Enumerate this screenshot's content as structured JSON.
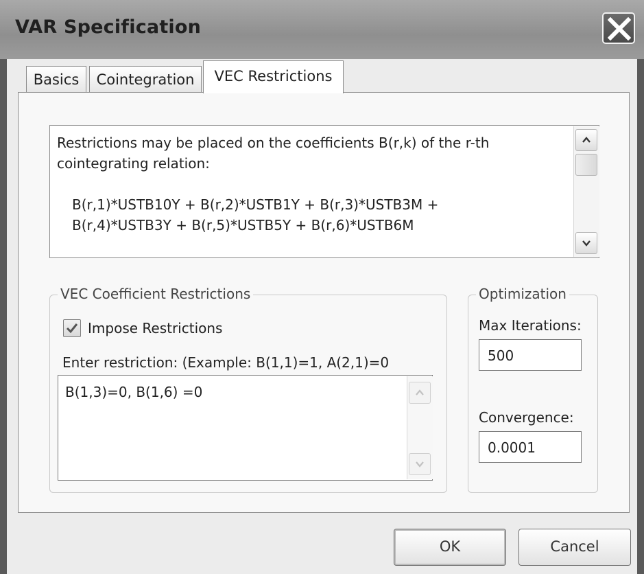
{
  "window": {
    "title": "VAR Specification"
  },
  "tabs": [
    {
      "label": "Basics",
      "active": false
    },
    {
      "label": "Cointegration",
      "active": false
    },
    {
      "label": "VEC Restrictions",
      "active": true
    }
  ],
  "info": {
    "line1": "Restrictions may be placed on the coefficients B(r,k) of the r-th",
    "line2": "cointegrating relation:",
    "formula1": "B(r,1)*USTB10Y + B(r,2)*USTB1Y + B(r,3)*USTB3M +",
    "formula2": "B(r,4)*USTB3Y + B(r,5)*USTB5Y + B(r,6)*USTB6M"
  },
  "vec_restrictions": {
    "group_label": "VEC Coefficient Restrictions",
    "impose_label": "Impose Restrictions",
    "impose_checked": true,
    "prompt": "Enter restriction:  (Example:  B(1,1)=1, A(2,1)=0",
    "value": "B(1,3)=0, B(1,6) =0"
  },
  "optimization": {
    "group_label": "Optimization",
    "max_iterations_label": "Max Iterations:",
    "max_iterations_value": "500",
    "convergence_label": "Convergence:",
    "convergence_value": "0.0001"
  },
  "buttons": {
    "ok": "OK",
    "cancel": "Cancel"
  },
  "icons": {
    "close": "close-icon",
    "scroll_up": "chevron-up-icon",
    "scroll_down": "chevron-down-icon",
    "check": "checkmark-icon"
  }
}
